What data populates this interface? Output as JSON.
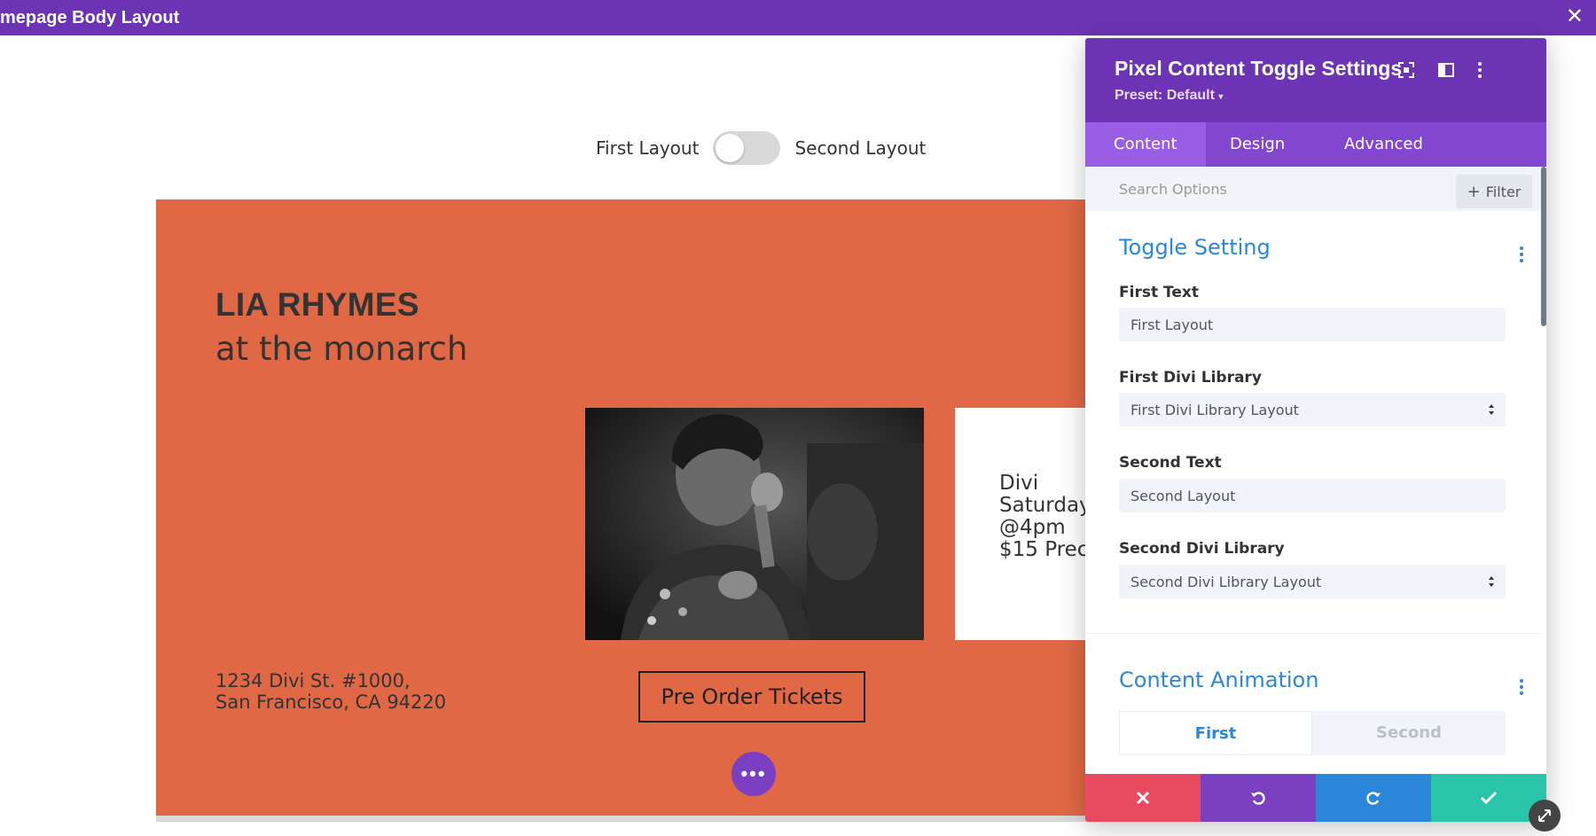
{
  "topbar": {
    "title": "mepage Body Layout",
    "close_icon": "close-icon"
  },
  "page_toggle": {
    "first_label": "First Layout",
    "second_label": "Second Layout",
    "is_on": false
  },
  "hero": {
    "title": "LIA RHYMES",
    "subtitle": "at the monarch",
    "info_lines": [
      "Divi",
      "Saturday",
      "@4pm",
      "$15 Prec"
    ],
    "address_line1": "1234 Divi St. #1000,",
    "address_line2": "San Francisco, CA 94220",
    "cta": "Pre Order Tickets",
    "photo_alt": "singer-photo",
    "bg_color": "#e06845"
  },
  "panel": {
    "title": "Pixel Content Toggle Settings",
    "preset": "Preset: Default",
    "tabs": [
      {
        "label": "Content",
        "active": true
      },
      {
        "label": "Design",
        "active": false
      },
      {
        "label": "Advanced",
        "active": false
      }
    ],
    "search_placeholder": "Search Options",
    "filter_label": "Filter",
    "toggle_setting": {
      "title": "Toggle Setting",
      "first_text_label": "First Text",
      "first_text_value": "First Layout",
      "first_library_label": "First Divi Library",
      "first_library_value": "First Divi Library Layout",
      "second_text_label": "Second Text",
      "second_text_value": "Second Layout",
      "second_library_label": "Second Divi Library",
      "second_library_value": "Second Divi Library Layout"
    },
    "content_animation": {
      "title": "Content Animation",
      "options": [
        "First",
        "Second"
      ],
      "selected": "First"
    },
    "footer_colors": {
      "cancel": "#e84a5f",
      "undo": "#7b3fc2",
      "redo": "#2b87da",
      "save": "#29c4a9"
    }
  },
  "colors": {
    "brand_purple": "#6c34b4",
    "link_blue": "#2b87da"
  }
}
